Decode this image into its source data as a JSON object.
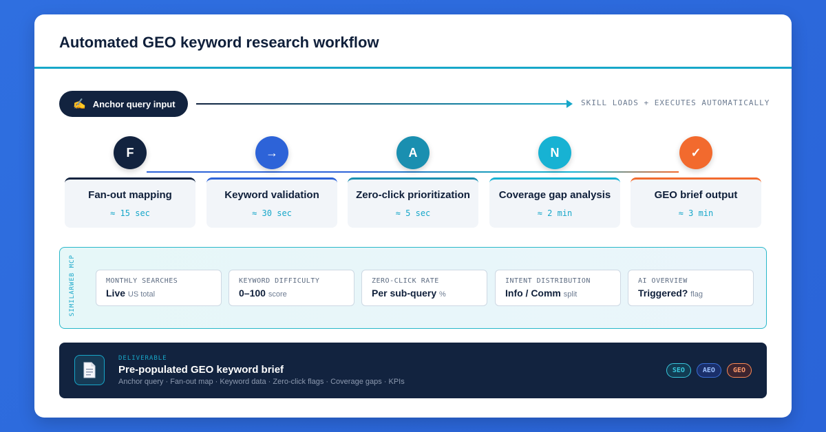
{
  "title": "Automated GEO keyword research workflow",
  "anchor": {
    "icon": "writing-hand-icon",
    "glyph": "✍",
    "label": "Anchor query input"
  },
  "auto_text": "SKILL LOADS + EXECUTES AUTOMATICALLY",
  "steps": [
    {
      "letter": "F",
      "name": "Fan-out mapping",
      "time": "≈ 15 sec",
      "color": "#12233f"
    },
    {
      "letter": "→",
      "name": "Keyword validation",
      "time": "≈ 30 sec",
      "color": "#2d63d8"
    },
    {
      "letter": "A",
      "name": "Zero-click prioritization",
      "time": "≈ 5 sec",
      "color": "#1a8fb0"
    },
    {
      "letter": "N",
      "name": "Coverage gap analysis",
      "time": "≈ 2 min",
      "color": "#17b2d3"
    },
    {
      "letter": "✓",
      "name": "GEO brief output",
      "time": "≈ 3 min",
      "color": "#f26a2e"
    }
  ],
  "mcp": {
    "label": "SIMILARWEB MCP",
    "metrics": [
      {
        "label": "MONTHLY SEARCHES",
        "value": "Live",
        "unit": "US total"
      },
      {
        "label": "KEYWORD DIFFICULTY",
        "value": "0–100",
        "unit": "score"
      },
      {
        "label": "ZERO-CLICK RATE",
        "value": "Per sub-query",
        "unit": "%"
      },
      {
        "label": "INTENT DISTRIBUTION",
        "value": "Info / Comm",
        "unit": "split"
      },
      {
        "label": "AI OVERVIEW",
        "value": "Triggered?",
        "unit": "flag"
      }
    ]
  },
  "deliverable": {
    "icon": "document-icon",
    "eyebrow": "DELIVERABLE",
    "title": "Pre-populated GEO keyword brief",
    "subtitle": "Anchor query · Fan-out map · Keyword data · Zero-click flags · Coverage gaps · KPIs",
    "tags": [
      "SEO",
      "AEO",
      "GEO"
    ]
  }
}
